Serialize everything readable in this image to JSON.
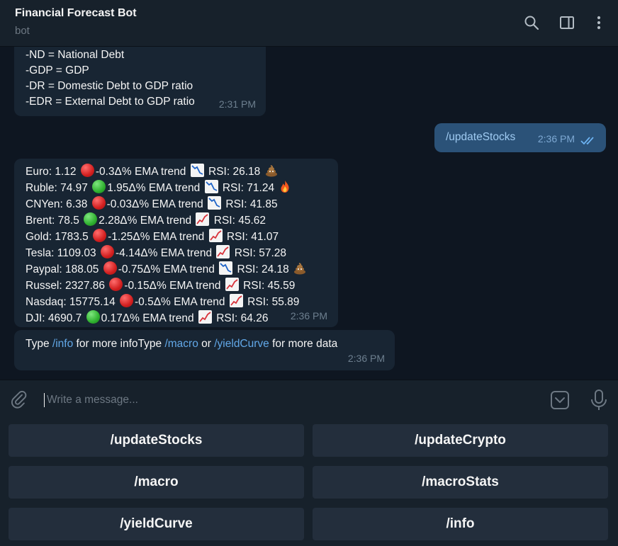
{
  "header": {
    "title": "Financial Forecast Bot",
    "subtitle": "bot"
  },
  "messages": {
    "legend": {
      "lines": [
        "-ND = National Debt",
        "-GDP = GDP",
        "-DR = Domestic Debt to GDP ratio",
        "-EDR = External Debt to GDP ratio"
      ],
      "time": "2:31 PM"
    },
    "outgoing": {
      "text": "/updateStocks",
      "time": "2:36 PM"
    },
    "stocks": {
      "rows": [
        {
          "pre": "Euro: 1.12",
          "dot": "red",
          "change": "-0.3Δ% EMA trend",
          "chart": "down",
          "rsi": "RSI: 26.18",
          "extra": "poop"
        },
        {
          "pre": "Ruble: 74.97",
          "dot": "green",
          "change": "1.95Δ% EMA trend",
          "chart": "down",
          "rsi": "RSI: 71.24",
          "extra": "fire"
        },
        {
          "pre": "CNYen: 6.38",
          "dot": "red",
          "change": "-0.03Δ% EMA trend",
          "chart": "down",
          "rsi": "RSI: 41.85",
          "extra": ""
        },
        {
          "pre": "Brent: 78.5",
          "dot": "green",
          "change": "2.28Δ% EMA trend",
          "chart": "up",
          "rsi": "RSI: 45.62",
          "extra": ""
        },
        {
          "pre": "Gold: 1783.5",
          "dot": "red",
          "change": "-1.25Δ% EMA trend",
          "chart": "up",
          "rsi": "RSI: 41.07",
          "extra": ""
        },
        {
          "pre": "Tesla: 1109.03",
          "dot": "red",
          "change": "-4.14Δ% EMA trend",
          "chart": "up",
          "rsi": "RSI: 57.28",
          "extra": ""
        },
        {
          "pre": "Paypal: 188.05",
          "dot": "red",
          "change": "-0.75Δ% EMA trend",
          "chart": "down",
          "rsi": "RSI: 24.18",
          "extra": "poop"
        },
        {
          "pre": "Russel: 2327.86",
          "dot": "red",
          "change": "-0.15Δ% EMA trend",
          "chart": "up",
          "rsi": "RSI: 45.59",
          "extra": ""
        },
        {
          "pre": "Nasdaq: 15775.14",
          "dot": "red",
          "change": "-0.5Δ% EMA trend",
          "chart": "up",
          "rsi": "RSI: 55.89",
          "extra": ""
        },
        {
          "pre": "DJI: 4690.7",
          "dot": "green",
          "change": "0.17Δ% EMA trend",
          "chart": "up",
          "rsi": "RSI: 64.26",
          "extra": ""
        }
      ],
      "time": "2:36 PM"
    },
    "info": {
      "t1": "Type ",
      "l1": "/info",
      "t2": " for more infoType ",
      "l2": "/macro",
      "t3": " or ",
      "l3": "/yieldCurve",
      "t4": " for more data",
      "time": "2:36 PM"
    }
  },
  "composer": {
    "placeholder": "Write a message..."
  },
  "keyboard": {
    "buttons": [
      "/updateStocks",
      "/updateCrypto",
      "/macro",
      "/macroStats",
      "/yieldCurve",
      "/info"
    ]
  },
  "colors": {
    "background": "#0e1621",
    "panel": "#17212b",
    "incoming_bubble": "#182533",
    "outgoing_bubble": "#2b5278",
    "link": "#62a8e8",
    "keyboard_button": "#232e3c"
  },
  "icons": [
    "search-icon",
    "sidebar-toggle-icon",
    "more-vertical-icon",
    "attach-icon",
    "emoji-icon",
    "mic-icon",
    "double-check-icon",
    "red-circle-icon",
    "green-circle-icon",
    "chart-decreasing-icon",
    "chart-increasing-icon",
    "poop-icon",
    "fire-icon"
  ]
}
